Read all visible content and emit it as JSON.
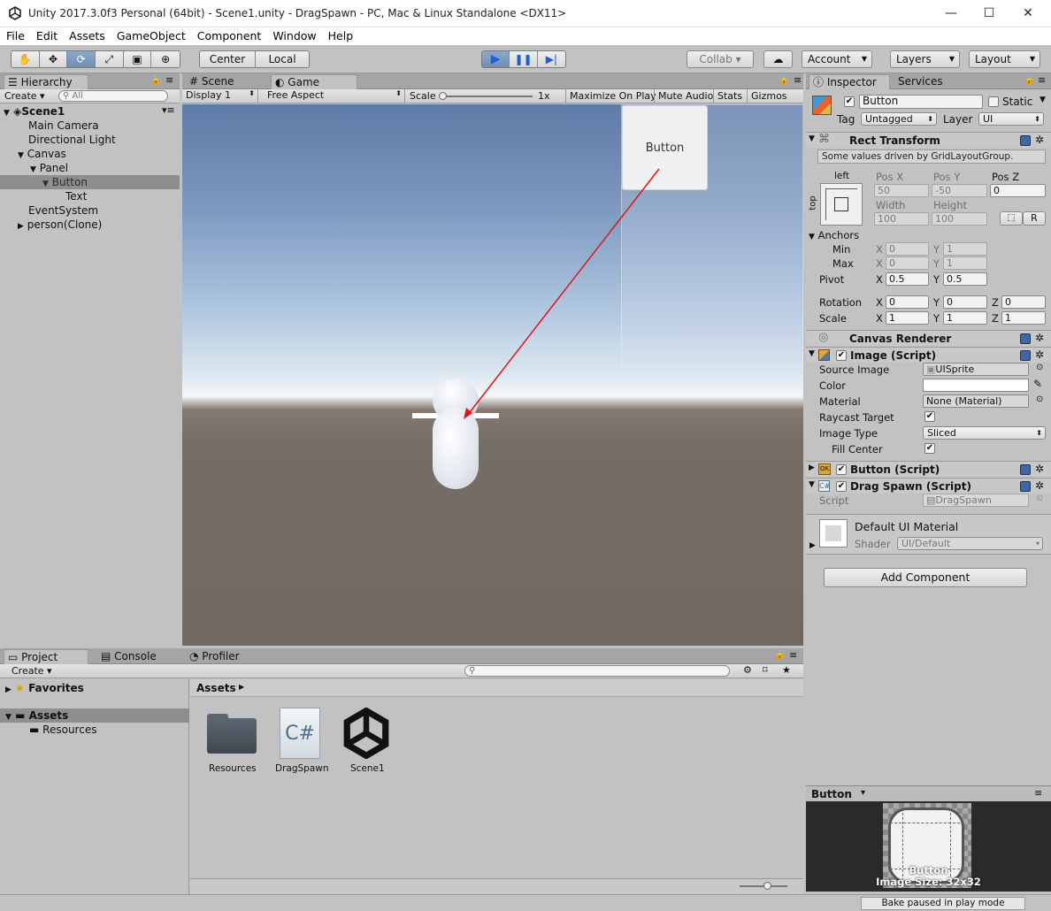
{
  "window": {
    "title": "Unity 2017.3.0f3 Personal (64bit) - Scene1.unity - DragSpawn - PC, Mac & Linux Standalone <DX11>",
    "minimize": "—",
    "maximize": "☐",
    "close": "✕"
  },
  "menu": [
    "File",
    "Edit",
    "Assets",
    "GameObject",
    "Component",
    "Window",
    "Help"
  ],
  "toolbar": {
    "pivot": "Center",
    "space": "Local",
    "collab": "Collab ▾",
    "account": "Account",
    "layers": "Layers",
    "layout": "Layout"
  },
  "hierarchy": {
    "tab": "Hierarchy",
    "create": "Create ▾",
    "search_placeholder": "All",
    "scene": "Scene1",
    "items": [
      "Main Camera",
      "Directional Light",
      "Canvas",
      "Panel",
      "Button",
      "Text",
      "EventSystem",
      "person(Clone)"
    ]
  },
  "view_tabs": {
    "scene": "Scene",
    "game": "Game"
  },
  "game_bar": {
    "display": "Display 1",
    "aspect": "Free Aspect",
    "scale_label": "Scale",
    "scale_value": "1x",
    "maximize": "Maximize On Play",
    "mute": "Mute Audio",
    "stats": "Stats",
    "gizmos": "Gizmos"
  },
  "game_view": {
    "button_text": "Button"
  },
  "inspector": {
    "tab": "Inspector",
    "services_tab": "Services",
    "object_name": "Button",
    "static_label": "Static",
    "tag_label": "Tag",
    "tag_value": "Untagged",
    "layer_label": "Layer",
    "layer_value": "UI",
    "rect": {
      "title": "Rect Transform",
      "note": "Some values driven by GridLayoutGroup.",
      "anchor_h": "left",
      "anchor_v": "top",
      "posx_label": "Pos X",
      "posx": "50",
      "posy_label": "Pos Y",
      "posy": "-50",
      "posz_label": "Pos Z",
      "posz": "0",
      "width_label": "Width",
      "width": "100",
      "height_label": "Height",
      "height": "100",
      "r_button": "R",
      "anchors": "Anchors",
      "min": "Min",
      "min_x": "0",
      "min_y": "1",
      "max": "Max",
      "max_x": "0",
      "max_y": "1",
      "pivot": "Pivot",
      "pivot_x": "0.5",
      "pivot_y": "0.5",
      "rotation": "Rotation",
      "rot_x": "0",
      "rot_y": "0",
      "rot_z": "0",
      "scale": "Scale",
      "scale_x": "1",
      "scale_y": "1",
      "scale_z": "1",
      "x": "X",
      "y": "Y",
      "z": "Z"
    },
    "canvas_renderer": "Canvas Renderer",
    "image": {
      "title": "Image (Script)",
      "source_label": "Source Image",
      "source": "UISprite",
      "color_label": "Color",
      "material_label": "Material",
      "material": "None (Material)",
      "raycast_label": "Raycast Target",
      "type_label": "Image Type",
      "type": "Sliced",
      "fill_label": "Fill Center"
    },
    "button_script": "Button (Script)",
    "drag_spawn": {
      "title": "Drag Spawn (Script)",
      "script_label": "Script",
      "script": "DragSpawn"
    },
    "material": {
      "name": "Default UI Material",
      "shader_label": "Shader",
      "shader": "UI/Default"
    },
    "add_component": "Add Component"
  },
  "preview": {
    "title": "Button",
    "caption_name": "Button",
    "caption_size": "Image Size: 32x32"
  },
  "project": {
    "tab": "Project",
    "console_tab": "Console",
    "profiler_tab": "Profiler",
    "create": "Create ▾",
    "favorites": "Favorites",
    "assets": "Assets",
    "resources": "Resources",
    "breadcrumb": "Assets",
    "files": [
      "Resources",
      "DragSpawn",
      "Scene1"
    ]
  },
  "status": {
    "bake": "Bake paused in play mode"
  }
}
